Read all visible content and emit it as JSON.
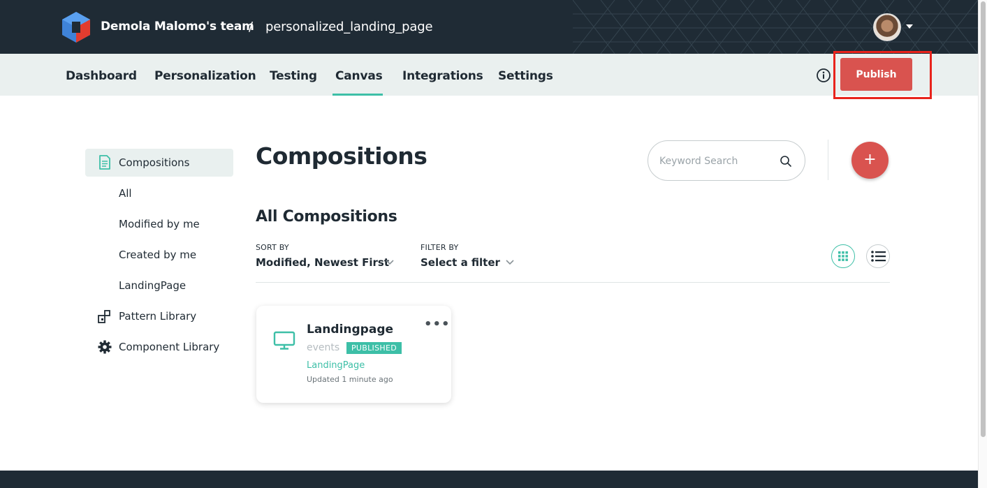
{
  "header": {
    "team_name": "Demola Malomo's team",
    "separator": "/",
    "project_name": "personalized_landing_page",
    "logo_icon": "uniform-logo-icon",
    "avatar_icon": "user-avatar"
  },
  "nav": {
    "tabs": [
      {
        "label": "Dashboard"
      },
      {
        "label": "Personalization"
      },
      {
        "label": "Testing"
      },
      {
        "label": "Canvas",
        "active": true
      },
      {
        "label": "Integrations"
      },
      {
        "label": "Settings"
      }
    ],
    "info_icon": "info-icon",
    "publish_label": "Publish"
  },
  "sidebar": {
    "items": [
      {
        "label": "Compositions",
        "icon": "document-icon",
        "active": true
      },
      {
        "label": "All"
      },
      {
        "label": "Modified by me"
      },
      {
        "label": "Created by me"
      },
      {
        "label": "LandingPage"
      },
      {
        "label": "Pattern Library",
        "icon": "pattern-library-icon"
      },
      {
        "label": "Component Library",
        "icon": "gear-icon"
      }
    ]
  },
  "main": {
    "title": "Compositions",
    "search_placeholder": "Keyword Search",
    "add_label": "+",
    "section_title": "All Compositions",
    "sort": {
      "caption": "SORT BY",
      "value": "Modified, Newest First"
    },
    "filter": {
      "caption": "FILTER BY",
      "value": "Select a filter"
    },
    "view_mode": "grid"
  },
  "cards": [
    {
      "title": "Landingpage",
      "type": "events",
      "status": "PUBLISHED",
      "category": "LandingPage",
      "updated": "Updated 1 minute ago",
      "menu": "•••",
      "icon": "monitor-icon"
    }
  ],
  "colors": {
    "topbar": "#1f2b35",
    "navbar": "#eaf0ef",
    "accent": "#3dbfa7",
    "brand_red": "#d9534f",
    "highlight_box": "#e8231c"
  }
}
